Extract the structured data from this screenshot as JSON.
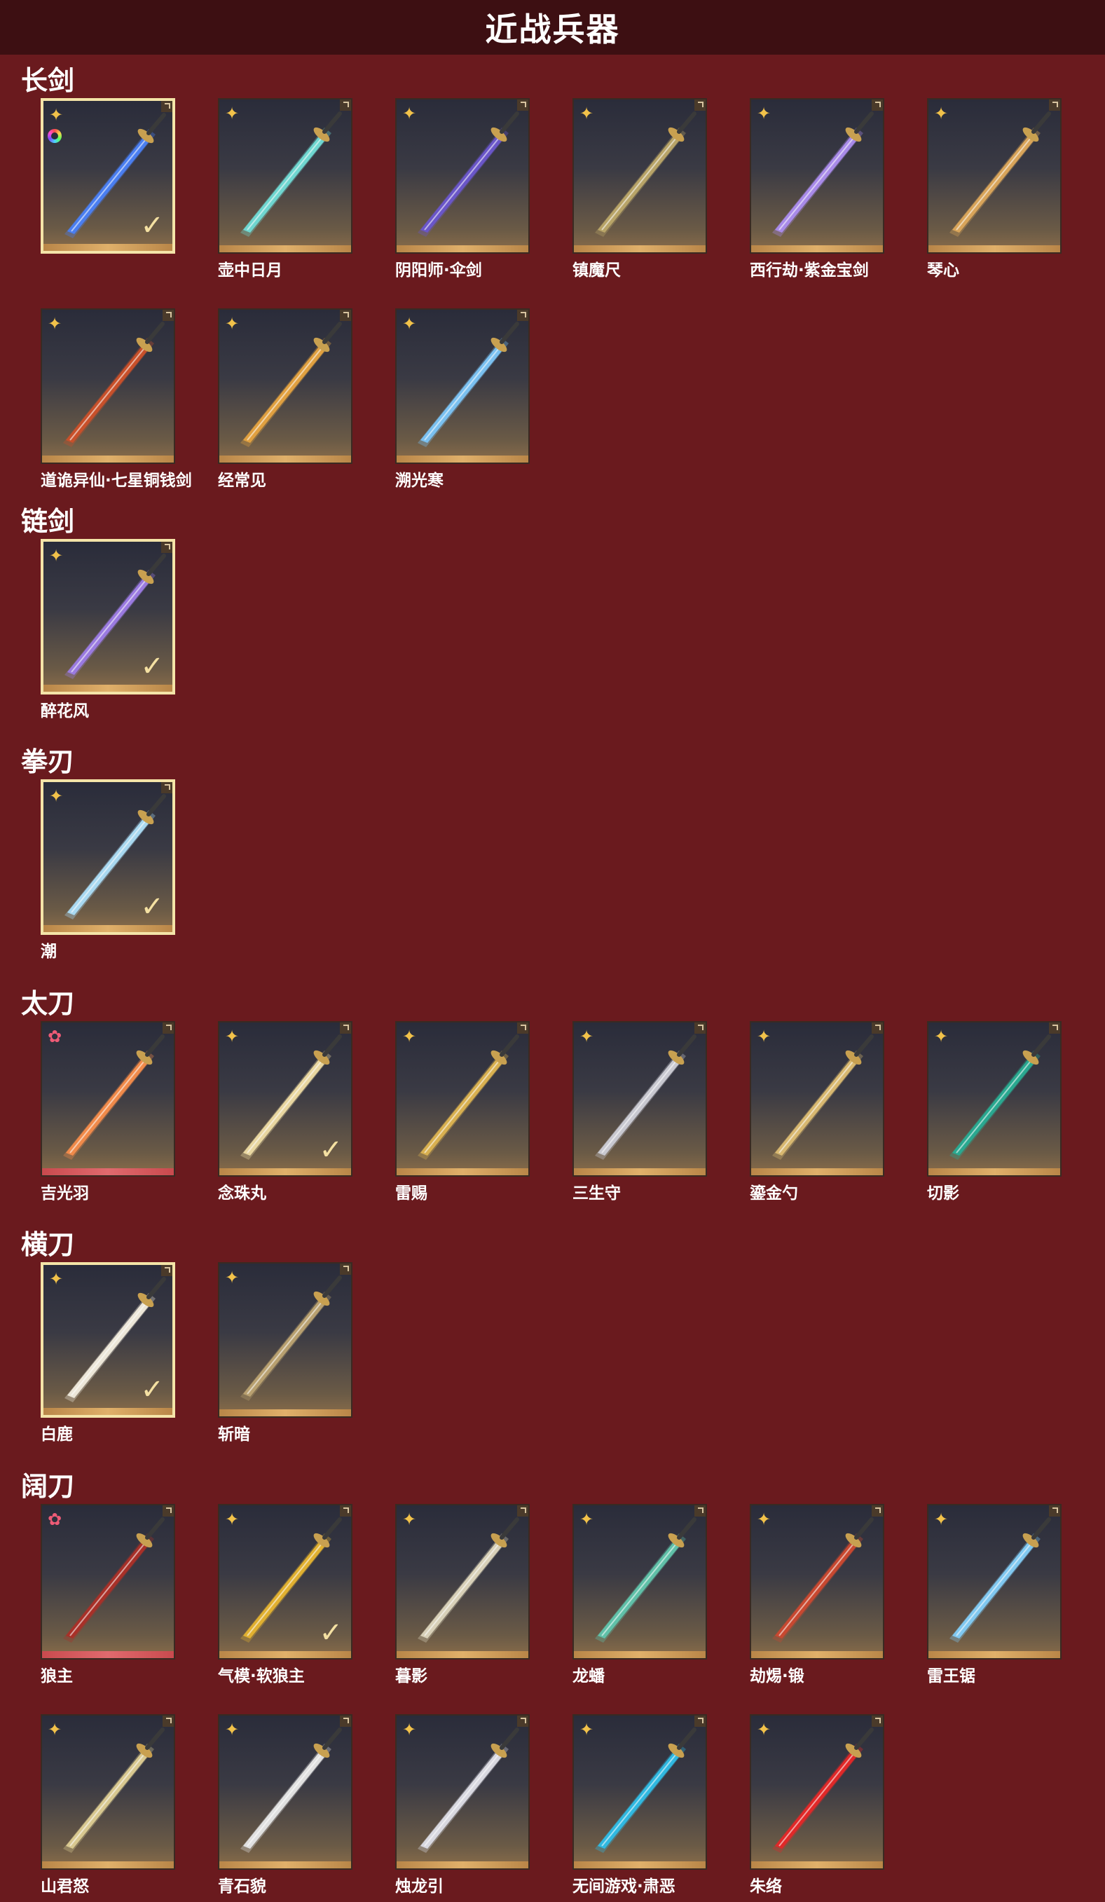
{
  "page": {
    "title": "近战兵器"
  },
  "sections": [
    {
      "name": "长剑",
      "items": [
        {
          "name": "",
          "rarity": "gold",
          "selected": true,
          "colorwheel": true,
          "checked": true,
          "blade": "#4a7ef0"
        },
        {
          "name": "壶中日月",
          "rarity": "gold",
          "blade": "#6fd6d0"
        },
        {
          "name": "阴阳师·伞剑",
          "rarity": "gold",
          "blade": "#6a56c8"
        },
        {
          "name": "镇魔尺",
          "rarity": "gold",
          "blade": "#b8a468"
        },
        {
          "name": "西行劫·紫金宝剑",
          "rarity": "gold",
          "blade": "#a88ae8"
        },
        {
          "name": "琴心",
          "rarity": "gold",
          "blade": "#d8a45a"
        },
        {
          "name": "道诡异仙·七星铜钱剑",
          "rarity": "gold",
          "blade": "#c8502a"
        },
        {
          "name": "经常见",
          "rarity": "gold",
          "blade": "#e0a040"
        },
        {
          "name": "溯光寒",
          "rarity": "gold",
          "blade": "#7ac0f0"
        }
      ]
    },
    {
      "name": "链剑",
      "items": [
        {
          "name": "醉花风",
          "rarity": "gold",
          "selected": true,
          "checked": true,
          "blade": "#9a7ae0"
        }
      ]
    },
    {
      "name": "拳刃",
      "items": [
        {
          "name": "潮",
          "rarity": "gold",
          "selected": true,
          "checked": true,
          "blade": "#a8d8f0"
        }
      ]
    },
    {
      "name": "太刀",
      "items": [
        {
          "name": "吉光羽",
          "rarity": "pink",
          "red": true,
          "blade": "#f08a4a"
        },
        {
          "name": "念珠丸",
          "rarity": "gold",
          "checked": true,
          "blade": "#e8d6a0"
        },
        {
          "name": "雷赐",
          "rarity": "gold",
          "blade": "#d8b050"
        },
        {
          "name": "三生守",
          "rarity": "gold",
          "blade": "#c8c8d0"
        },
        {
          "name": "鎏金勺",
          "rarity": "gold",
          "blade": "#d8b870"
        },
        {
          "name": "切影",
          "rarity": "gold",
          "blade": "#2aa890"
        }
      ]
    },
    {
      "name": "横刀",
      "items": [
        {
          "name": "白鹿",
          "rarity": "gold",
          "selected": true,
          "checked": true,
          "blade": "#ece6d8"
        },
        {
          "name": "斩暗",
          "rarity": "gold",
          "blade": "#b8a070"
        }
      ]
    },
    {
      "name": "阔刀",
      "items": [
        {
          "name": "狼主",
          "rarity": "pink",
          "red": true,
          "blade": "#a83028"
        },
        {
          "name": "气模·软狼主",
          "rarity": "gold",
          "checked": true,
          "blade": "#e0b030"
        },
        {
          "name": "暮影",
          "rarity": "gold",
          "blade": "#d8d0b8"
        },
        {
          "name": "龙蟠",
          "rarity": "gold",
          "blade": "#60c0a8"
        },
        {
          "name": "劫焬·锻",
          "rarity": "gold",
          "blade": "#c84830"
        },
        {
          "name": "雷王锯",
          "rarity": "gold",
          "blade": "#80c8f0"
        },
        {
          "name": "山君怒",
          "rarity": "gold",
          "blade": "#d8c890"
        },
        {
          "name": "青石貌",
          "rarity": "gold",
          "blade": "#e0e0e0"
        },
        {
          "name": "烛龙引",
          "rarity": "gold",
          "blade": "#d8d8e0"
        },
        {
          "name": "无间游戏·肃恶",
          "rarity": "gold",
          "blade": "#30b8e0"
        },
        {
          "name": "朱络",
          "rarity": "gold",
          "blade": "#e02828"
        }
      ]
    }
  ]
}
